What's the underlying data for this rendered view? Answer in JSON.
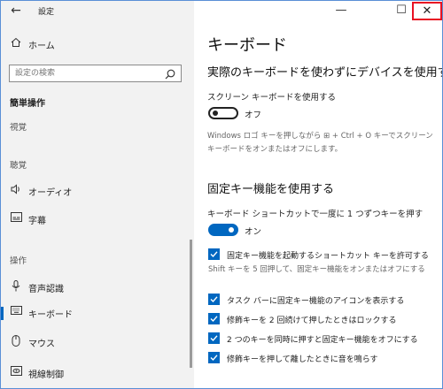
{
  "app": {
    "title": "設定",
    "back_icon": "arrow-left-icon"
  },
  "window_controls": {
    "minimize": "—",
    "maximize": "☐",
    "close": "✕"
  },
  "sidebar": {
    "home": "ホーム",
    "search_placeholder": "設定の検索",
    "category": "簡単操作",
    "vision": "視覚",
    "hearing": "聴覚",
    "audio": "オーディオ",
    "captions": "字幕",
    "interaction": "操作",
    "speech": "音声認識",
    "keyboard": "キーボード",
    "mouse": "マウス",
    "eye_control": "視線制御"
  },
  "main": {
    "title": "キーボード",
    "osk": {
      "heading": "実際のキーボードを使わずにデバイスを使用する",
      "toggle_label": "スクリーン キーボードを使用する",
      "state": "オフ",
      "desc": "Windows ロゴ キーを押しながら ⊞ + Ctrl + O キーでスクリーン キーボードをオンまたはオフにします。"
    },
    "sticky": {
      "heading": "固定キー機能を使用する",
      "toggle_label": "キーボード ショートカットで一度に 1 つずつキーを押す",
      "state": "オン",
      "cb1": "固定キー機能を起動するショートカット キーを許可する",
      "cb1_desc": "Shift キーを 5 回押して、固定キー機能をオンまたはオフにする",
      "cb2": "タスク バーに固定キー機能のアイコンを表示する",
      "cb3": "修飾キーを 2 回続けて押したときはロックする",
      "cb4": "2 つのキーを同時に押すと固定キー機能をオフにする",
      "cb5": "修飾キーを押して離したときに音を鳴らす"
    }
  },
  "colors": {
    "accent": "#0067c0",
    "close_highlight": "#e81123",
    "sidebar_bg": "#f2f2f2"
  }
}
